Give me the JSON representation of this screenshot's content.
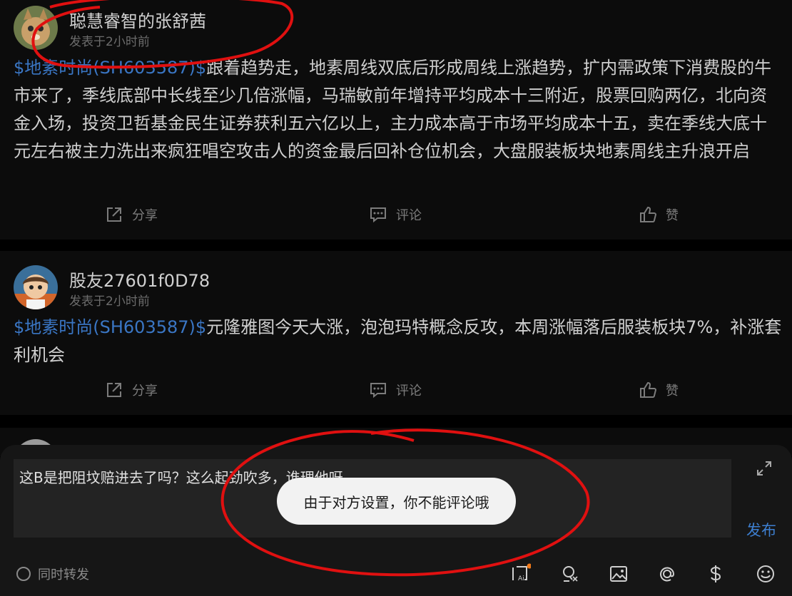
{
  "posts": [
    {
      "author": "聪慧睿智的张舒茜",
      "time": "发表于2小时前",
      "tag": "$地素时尚(SH603587)$",
      "text": "跟着趋势走，地素周线双底后形成周线上涨趋势，扩内需政策下消费股的牛市来了，季线底部中长线至少几倍涨幅，马瑞敏前年增持平均成本十三附近，股票回购两亿，北向资金入场，投资卫哲基金民生证券获利五六亿以上，主力成本高于市场平均成本十五，卖在季线大底十元左右被主力洗出来疯狂唱空攻击人的资金最后回补仓位机会，大盘服装板块地素周线主升浪开启",
      "share": "分享",
      "comment": "评论",
      "like": "赞"
    },
    {
      "author": "股友27601f0D78",
      "time": "发表于2小时前",
      "tag": "$地素时尚(SH603587)$",
      "text": "元隆雅图今天大涨，泡泡玛特概念反攻，本周涨幅落后服装板块7%，补涨套利机会",
      "share": "分享",
      "comment": "评论",
      "like": "赞"
    }
  ],
  "compose": {
    "text": "这B是把阻坟赔进去了吗？这么起劲吹多，谁理他呀",
    "publish": "发布",
    "repost": "同时转发",
    "toast": "由于对方设置，你不能评论哦"
  },
  "colors": {
    "tag": "#3a76c4",
    "annotation": "#e01010",
    "publish": "#3d7fd0"
  }
}
